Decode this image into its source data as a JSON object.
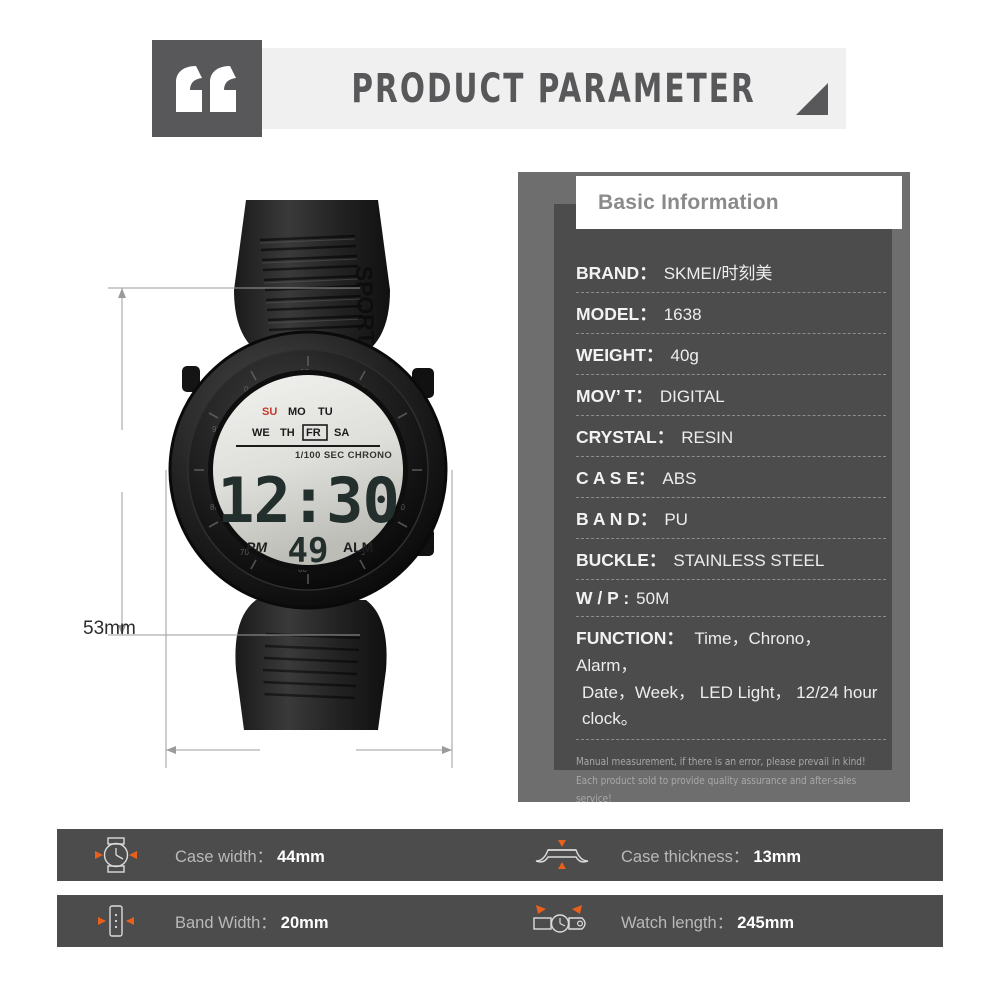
{
  "header": {
    "title": "PRODUCT PARAMETER",
    "quote_icon": "quote-mark-icon",
    "triangle_icon": "corner-triangle-icon",
    "accent_dark": "#58585a",
    "banner_bg": "#f0f0f0"
  },
  "product_photo": {
    "alt": "black digital sport watch front view",
    "brand_emboss": "SPORT",
    "lcd": {
      "days_row1": [
        "SU",
        "MO",
        "TU"
      ],
      "days_row2": [
        "WE",
        "TH",
        "FR",
        "SA"
      ],
      "active_day": "FR",
      "highlight_day": "SU",
      "chrono_label": "1/100 SEC CHRONO",
      "time": "12:30",
      "ampm": "PM",
      "seconds": "49",
      "alarm": "ALM"
    }
  },
  "dimensions": {
    "height_label": "53mm",
    "width_label": "44mm"
  },
  "spec_panel": {
    "heading": "Basic Information",
    "rows": [
      {
        "key": "BRAND：",
        "value": "SKMEI/时刻美"
      },
      {
        "key": "MODEL：",
        "value": "1638"
      },
      {
        "key": "WEIGHT：",
        "value": "40g"
      },
      {
        "key": "MOV’ T：",
        "value": "DIGITAL"
      },
      {
        "key": "CRYSTAL：",
        "value": "RESIN"
      },
      {
        "key": "C A S E：",
        "value": "ABS"
      },
      {
        "key": "B A N D：",
        "value": "PU"
      },
      {
        "key": "BUCKLE：",
        "value": "STAINLESS STEEL"
      },
      {
        "key": "W / P  :",
        "value": "50M"
      }
    ],
    "function_row": {
      "key": "FUNCTION：",
      "value": "Time，Chrono， Alarm，",
      "value_line2": "Date，Week， LED Light， 12/24 hour clock。"
    },
    "note_line1": "Manual measurement, if there is an error, please prevail in kind!",
    "note_line2": "Each product sold to provide quality assurance and after-sales service!",
    "outer_bg": "#6e6e6e",
    "inner_bg": "#4c4c4c"
  },
  "features": [
    {
      "icon": "watch-case-width-icon",
      "label": "Case width：",
      "value": "44mm"
    },
    {
      "icon": "watch-band-width-icon",
      "label": "Band Width：",
      "value": "20mm"
    },
    {
      "icon": "watch-thickness-icon",
      "label": "Case thickness：",
      "value": "13mm"
    },
    {
      "icon": "watch-length-icon",
      "label": "Watch length：",
      "value": "245mm"
    }
  ],
  "colors": {
    "accent_orange": "#e8601c",
    "bar_bg": "#4c4c4c",
    "page_bg": "#ffffff"
  }
}
